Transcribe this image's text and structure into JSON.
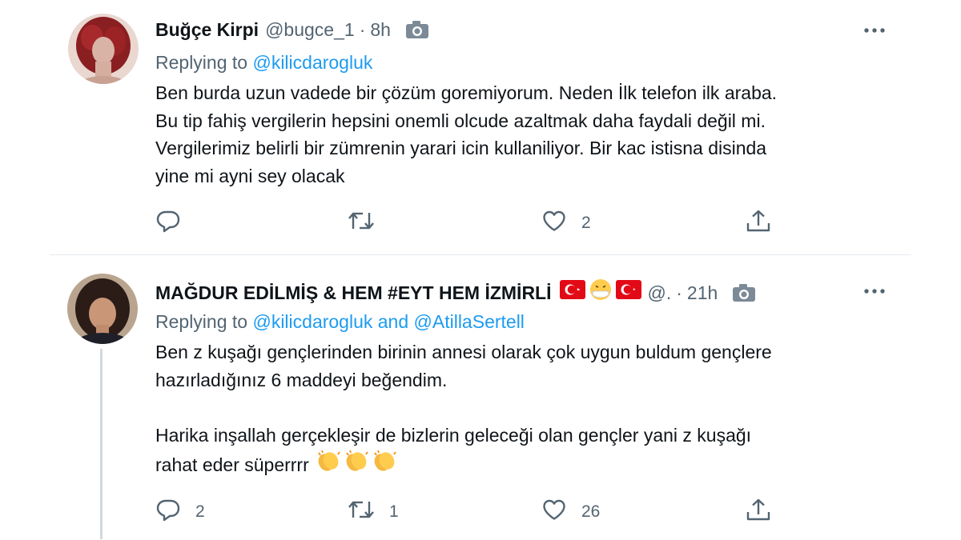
{
  "tweets": [
    {
      "name": "Buğçe Kirpi",
      "handle": "@bugce_1",
      "separator": "·",
      "time": "8h",
      "replying_prefix": "Replying to ",
      "replying_link": "@kilicdarogluk",
      "lines": [
        "Ben burda uzun vadede bir çözüm goremiyorum.  Neden İlk telefon ilk araba.",
        "Bu tip fahiş vergilerin hepsini onemli olcude azaltmak daha faydali değil mi.",
        "Vergilerimiz belirli bir zümrenin yarari icin kullaniliyor. Bir kac istisna disinda",
        "yine mi ayni sey olacak"
      ],
      "actions": {
        "reply": "",
        "retweet": "",
        "like": "2",
        "share": ""
      }
    },
    {
      "name": "MAĞDUR EDİLMİŞ & HEM #EYT HEM İZMİRLİ",
      "name_emojis": [
        "turkish-flag",
        "mask-face",
        "turkish-flag"
      ],
      "handle": "@.",
      "separator": "·",
      "time": "21h",
      "replying_prefix": "Replying to ",
      "replying_link": "@kilicdarogluk and @AtillaSertell",
      "lines": [
        "Ben z kuşağı gençlerinden birinin annesi olarak çok uygun buldum gençlere",
        "hazırladığınız 6 maddeyi beğendim.",
        "",
        "Harika inşallah gerçekleşir de bizlerin geleceği olan  gençler yani z kuşağı",
        "rahat eder süperrrr"
      ],
      "trailing_emojis": [
        "clapping-hands",
        "clapping-hands",
        "clapping-hands"
      ],
      "actions": {
        "reply": "2",
        "retweet": "1",
        "like": "26",
        "share": ""
      }
    }
  ],
  "colors": {
    "text": "#0f1419",
    "secondary": "#536471",
    "link": "#1d9bf0",
    "divider": "#e6ebee",
    "thread_line": "#cfd9de",
    "flag_red": "#e30a17"
  },
  "icons": [
    "camera-icon",
    "more-icon",
    "reply-icon",
    "retweet-icon",
    "like-icon",
    "share-icon"
  ]
}
